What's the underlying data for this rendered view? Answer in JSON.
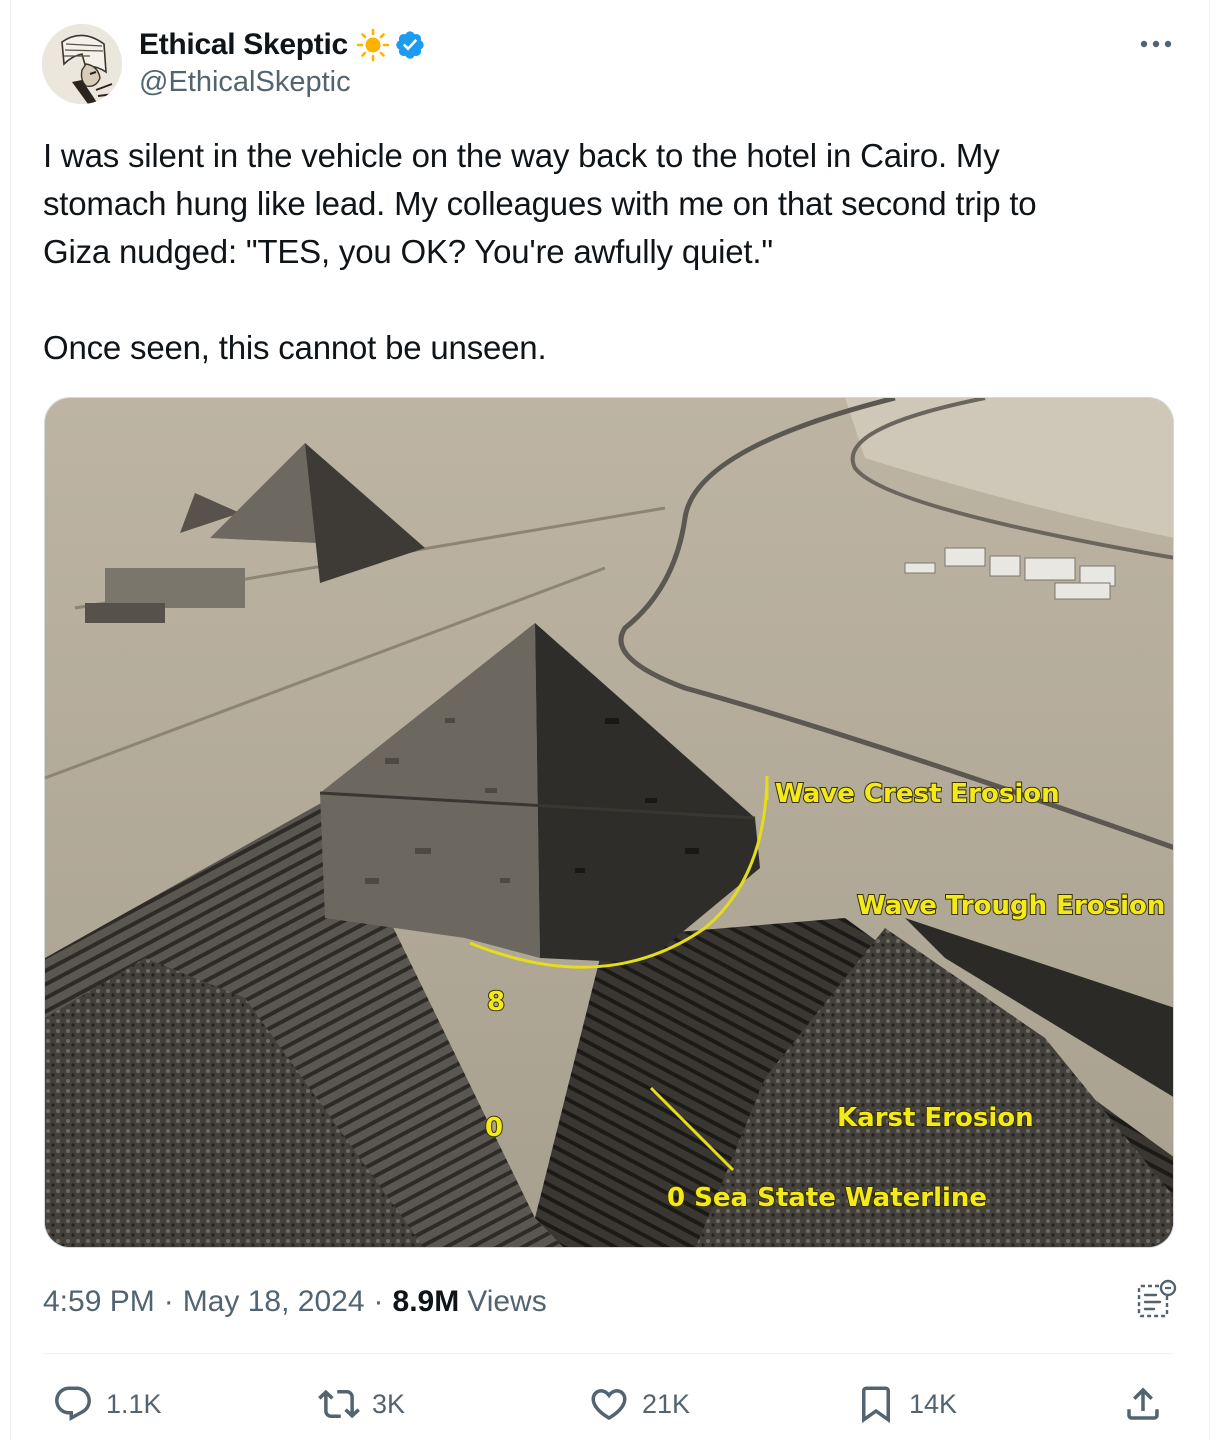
{
  "author": {
    "display_name": "Ethical Skeptic",
    "handle": "@EthicalSkeptic",
    "verified": true,
    "avatar_icon": "pharaoh-sketch-avatar",
    "badge_emoji": "sun-icon"
  },
  "tweet": {
    "paragraphs": [
      "I was silent in the vehicle on the way back to the hotel in Cairo. My",
      "stomach hung like lead. My colleagues with me on that second trip to",
      "Giza nudged: \"TES, you OK? You're awfully quiet.\"",
      "Once seen, this cannot be unseen."
    ]
  },
  "media": {
    "annotations": {
      "wave_crest": "Wave Crest Erosion",
      "wave_trough": "Wave Trough Erosion",
      "karst": "Karst Erosion",
      "sea_state": "0 Sea State  Waterline",
      "marker_8": "8",
      "marker_0": "0"
    },
    "annotation_color": "#f3ea1c"
  },
  "meta": {
    "time": "4:59 PM",
    "date": "May 18, 2024",
    "dot": "·",
    "views_count": "8.9M",
    "views_label": "Views"
  },
  "actions": {
    "replies": "1.1K",
    "reposts": "3K",
    "likes": "21K",
    "bookmarks": "14K"
  },
  "colors": {
    "text_primary": "#0f1419",
    "text_secondary": "#536471",
    "verified_blue": "#1d9bf0",
    "border": "#eff3f4"
  }
}
